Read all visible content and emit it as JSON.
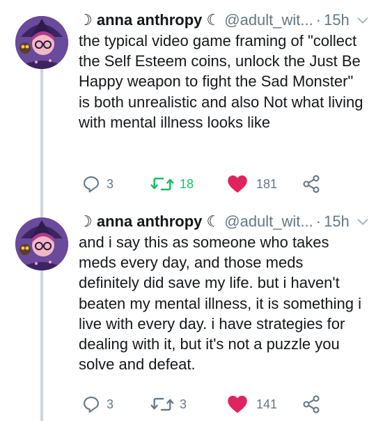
{
  "tweets": [
    {
      "name": "☽ anna anthropy ☾",
      "handle": "@adult_wit...",
      "dot": "·",
      "time": "15h",
      "text": "the typical video game framing of \"collect the Self Esteem coins, unlock the Just Be Happy weapon to fight the Sad Monster\" is both unrealistic and also Not what living with mental illness looks like",
      "replies": "3",
      "retweets": "18",
      "likes": "181",
      "retweeted": true,
      "liked": true
    },
    {
      "name": "☽ anna anthropy ☾",
      "handle": "@adult_wit...",
      "dot": "·",
      "time": "15h",
      "text": "and i say this as someone who takes meds every day, and those meds definitely did save my life. but i haven't beaten my mental illness, it is something i live with every day. i have strategies for dealing with it, but it's not a puzzle you solve and defeat.",
      "replies": "3",
      "retweets": "3",
      "likes": "141",
      "retweeted": false,
      "liked": true
    }
  ],
  "icons": {
    "reply": "reply-icon",
    "retweet": "retweet-icon",
    "like": "heart-icon",
    "share": "share-icon",
    "caret": "chevron-down-icon"
  },
  "colors": {
    "text": "#14171a",
    "muted": "#657786",
    "retweet": "#17bf63",
    "like": "#e0245e",
    "thread": "#ccd6dd"
  }
}
